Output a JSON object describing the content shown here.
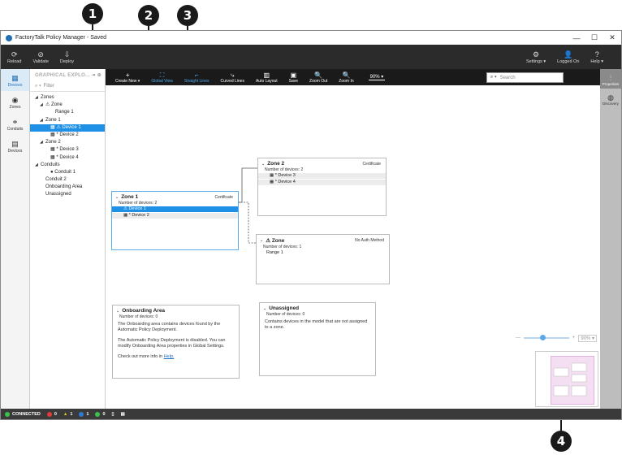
{
  "callouts": [
    "1",
    "2",
    "3",
    "4"
  ],
  "window": {
    "title": "FactoryTalk Policy Manager - Saved",
    "controls": {
      "minimize": "—",
      "maximize": "☐",
      "close": "✕"
    }
  },
  "ribbon": {
    "left": [
      {
        "label": "Reload",
        "icon": "⟳"
      },
      {
        "label": "Validate",
        "icon": "⊘"
      },
      {
        "label": "Deploy",
        "icon": "⇩"
      }
    ],
    "right": [
      {
        "label": "Settings ▾",
        "icon": "⚙"
      },
      {
        "label": "Logged On",
        "icon": "👤"
      },
      {
        "label": "Help ▾",
        "icon": "?"
      }
    ]
  },
  "leftnav": [
    {
      "label": "Devices",
      "icon": "▦",
      "active": true
    },
    {
      "label": "Zones",
      "icon": "◉",
      "active": false
    },
    {
      "label": "Conduits",
      "icon": "⚭",
      "active": false
    },
    {
      "label": "Devices",
      "icon": "▤",
      "active": false
    }
  ],
  "tree": {
    "header": "GRAPHICAL EXPLO...",
    "pin": "⇥ ⊕",
    "filter_placeholder": "Filter",
    "items": [
      {
        "label": "Zones",
        "indent": 0,
        "twisty": "◢"
      },
      {
        "label": "⚠ Zone",
        "indent": 1,
        "twisty": "◢"
      },
      {
        "label": "Range 1",
        "indent": 3,
        "twisty": ""
      },
      {
        "label": "Zone 1",
        "indent": 1,
        "twisty": "◢"
      },
      {
        "label": "▦ ⚠ Device 1",
        "indent": 2,
        "twisty": "",
        "selected": true
      },
      {
        "label": "▦ * Device 2",
        "indent": 2,
        "twisty": ""
      },
      {
        "label": "Zone 2",
        "indent": 1,
        "twisty": "◢"
      },
      {
        "label": "▦ * Device 3",
        "indent": 2,
        "twisty": ""
      },
      {
        "label": "▦ * Device 4",
        "indent": 2,
        "twisty": ""
      },
      {
        "label": "Conduits",
        "indent": 0,
        "twisty": "◢"
      },
      {
        "label": "● Conduit 1",
        "indent": 2,
        "twisty": ""
      },
      {
        "label": "Conduit 2",
        "indent": 1,
        "twisty": ""
      },
      {
        "label": "Onboarding Area",
        "indent": 1,
        "twisty": ""
      },
      {
        "label": "Unassigned",
        "indent": 1,
        "twisty": ""
      }
    ]
  },
  "toolbar": {
    "buttons": [
      {
        "label": "Create New ▾",
        "icon": "+",
        "active": false
      },
      {
        "label": "Global View",
        "icon": "⛶",
        "active": true
      },
      {
        "label": "Straight Lines",
        "icon": "⌐",
        "active": true
      },
      {
        "label": "Curved Lines",
        "icon": "⤷",
        "active": false
      },
      {
        "label": "Auto Layout",
        "icon": "▥",
        "active": false
      },
      {
        "label": "Save",
        "icon": "▣",
        "active": false
      },
      {
        "label": "Zoom Out",
        "icon": "🔍",
        "active": false
      },
      {
        "label": "Zoom In",
        "icon": "🔍",
        "active": false
      }
    ],
    "zoom": "90% ▾",
    "search_placeholder": "Search"
  },
  "rightpanel": [
    {
      "label": "Properties",
      "icon": "⫶",
      "active": true
    },
    {
      "label": "Discovery",
      "icon": "◍",
      "active": false
    }
  ],
  "cards": {
    "zone1": {
      "title": "Zone 1",
      "tag": "Certificate",
      "count": "Number of devices: 2",
      "devices": [
        "⚠ Device 1",
        "▦ * Device 2"
      ]
    },
    "zone2": {
      "title": "Zone 2",
      "tag": "Certificate",
      "count": "Number of devices: 2",
      "devices": [
        "▦ * Device 3",
        "▦ * Device 4"
      ]
    },
    "zone": {
      "title": "⚠ Zone",
      "tag": "No Auth Method",
      "count": "Number of devices: 1",
      "devices": [
        "Range 1"
      ]
    },
    "onboarding": {
      "title": "Onboarding Area",
      "count": "Number of devices: 0",
      "p1": "The Onboarding area contains devices found by the Automatic Policy Deployment.",
      "p2": "The Automatic Policy Deployment is disabled. You can modify Onboarding Area properties in Global Settings.",
      "p3_prefix": "Check out more info in",
      "p3_link": "Help."
    },
    "unassigned": {
      "title": "Unassigned",
      "count": "Number of devices: 0",
      "text": "Contains devices in the model that are not assigned to a zone."
    }
  },
  "zoom_widget": {
    "minus": "—",
    "plus": "+",
    "value": "90% ▾"
  },
  "statusbar": {
    "connected": "CONNECTED",
    "errors": "0",
    "warnings": "1",
    "info": "1",
    "ok": "0",
    "colors": {
      "connected": "#3cc24a",
      "error": "#e03a3a",
      "warning": "#f0c419",
      "info": "#2b7bd6",
      "ok": "#3cc24a"
    }
  }
}
